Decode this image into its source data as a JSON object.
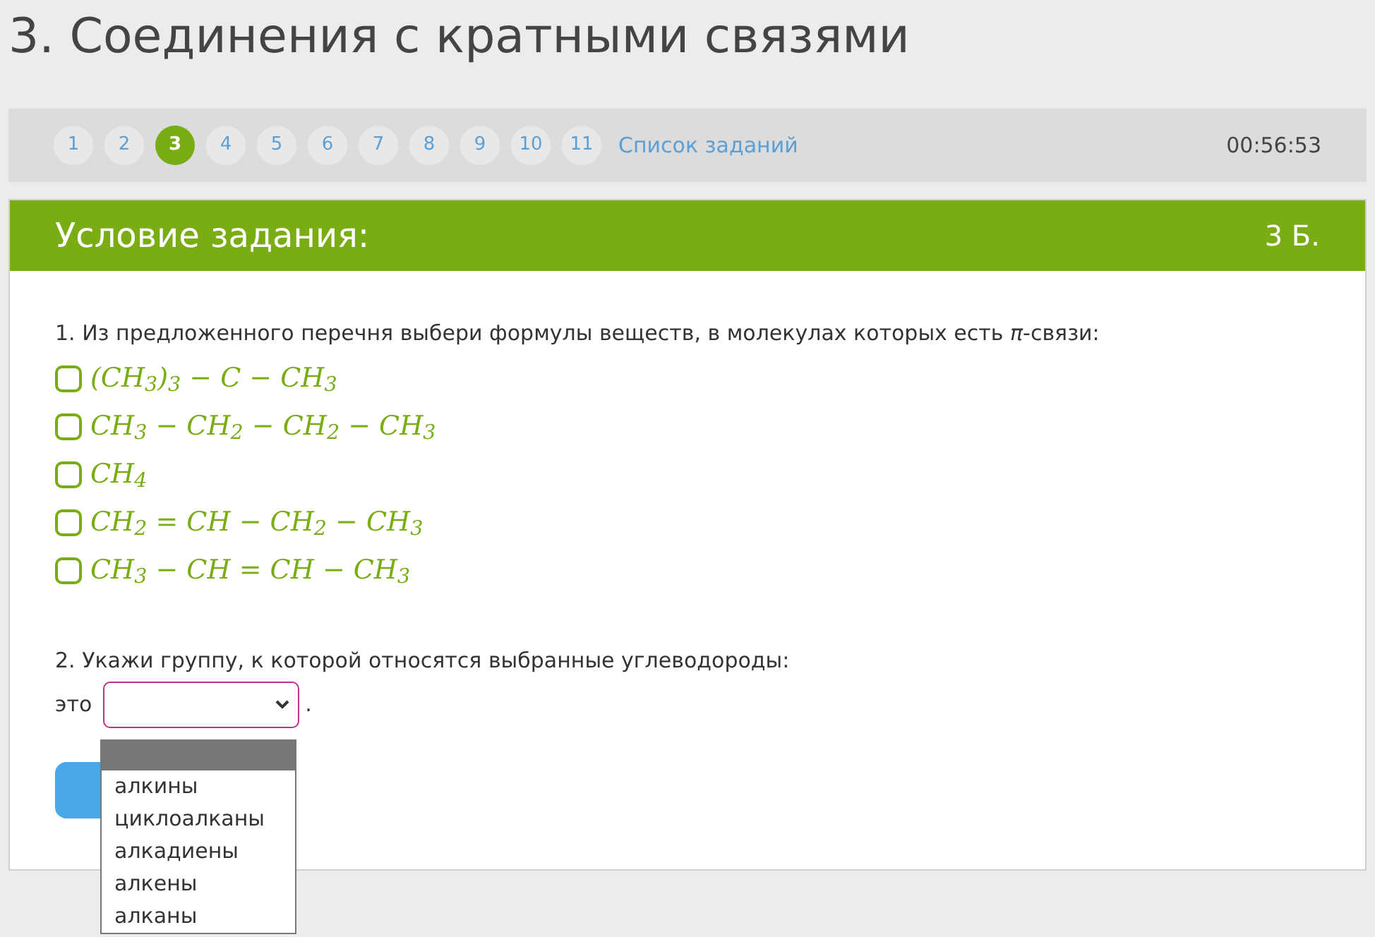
{
  "page_title": "3. Соединения с кратными связями",
  "nav": {
    "pages": [
      {
        "label": "1",
        "selected": false
      },
      {
        "label": "2",
        "selected": false
      },
      {
        "label": "3",
        "selected": true
      },
      {
        "label": "4",
        "selected": false
      },
      {
        "label": "5",
        "selected": false
      },
      {
        "label": "6",
        "selected": false
      },
      {
        "label": "7",
        "selected": false
      },
      {
        "label": "8",
        "selected": false
      },
      {
        "label": "9",
        "selected": false
      },
      {
        "label": "10",
        "selected": false
      },
      {
        "label": "11",
        "selected": false
      }
    ],
    "list_link": "Список заданий",
    "timer": "00:56:53"
  },
  "task": {
    "title": "Условие задания:",
    "points": "3 Б.",
    "question_1": "1. Из предложенного перечня выбери формулы веществ, в молекулах которых есть *π*-связи:",
    "choices": [
      {
        "formula": "(CH$_{3}$)$_{3}$ − C − CH$_{3}$",
        "checked": false
      },
      {
        "formula": "CH$_{3}$ − CH$_{2}$ − CH$_{2}$ − CH$_{3}$",
        "checked": false
      },
      {
        "formula": "CH$_{4}$",
        "checked": false
      },
      {
        "formula": "CH$_{2}$ = CH − CH$_{2}$ − CH$_{3}$",
        "checked": false
      },
      {
        "formula": "CH$_{3}$ − CH = CH − CH$_{3}$",
        "checked": false
      }
    ],
    "question_2": "2. Укажи группу, к которой относятся выбранные углеводороды:",
    "prefix": "это",
    "suffix": ".",
    "dropdown": {
      "expanded": true,
      "blank_option_highlighted": true,
      "options": [
        {
          "label": "алкины",
          "selected": false
        },
        {
          "label": "циклоалканы",
          "selected": false
        },
        {
          "label": "алкадиены",
          "selected": false
        },
        {
          "label": "алкены",
          "selected": false
        },
        {
          "label": "алканы",
          "selected": false
        }
      ]
    }
  }
}
